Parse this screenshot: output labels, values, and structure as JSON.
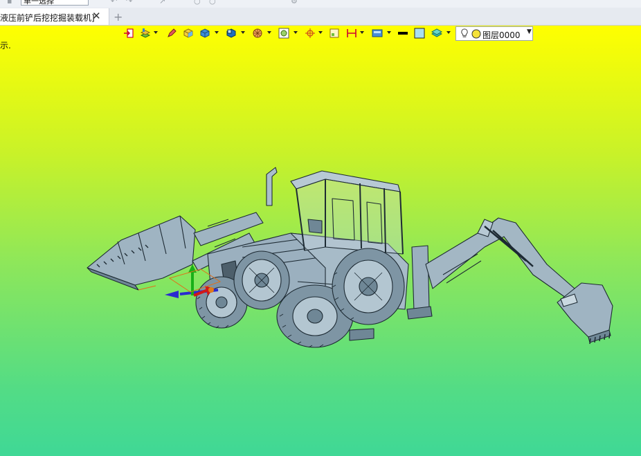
{
  "top": {
    "mode_select_value": "单一选择"
  },
  "tab": {
    "title": "液压前铲后挖挖掘装载机]",
    "close": "✕",
    "add": "+"
  },
  "viewport": {
    "hint": "示."
  },
  "toolbar": {
    "layer_value": "图层0000",
    "icons": [
      "exit-icon",
      "layer-stack-icon",
      "pen-icon",
      "cube-yellow-icon",
      "cube-blue-icon",
      "cube-shade-icon",
      "sphere-icon",
      "render-icon",
      "target-icon",
      "frame-icon",
      "ruler-icon",
      "view-icon",
      "line-color-icon",
      "fill-color-icon",
      "layer-manager-icon",
      "lightbulb-icon",
      "layer-color-icon"
    ]
  },
  "colors": {
    "viewport_top": "#ffff00",
    "viewport_bottom": "#3fd896",
    "model_fill": "#8aa1b1",
    "model_stroke": "#1d2a33"
  }
}
